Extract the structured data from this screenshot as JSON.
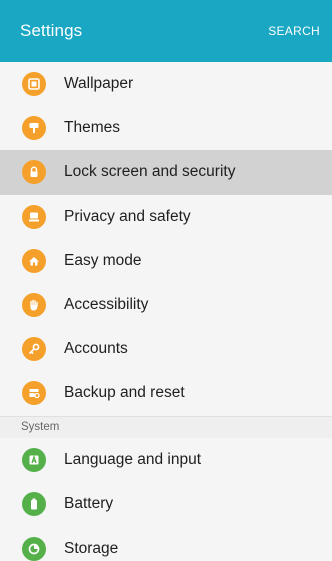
{
  "header": {
    "title": "Settings",
    "search_label": "SEARCH",
    "color": "#19a7c4"
  },
  "personal_items": [
    {
      "label": "Wallpaper",
      "icon": "wallpaper-icon",
      "color": "#f5a02a"
    },
    {
      "label": "Themes",
      "icon": "themes-brush-icon",
      "color": "#f5a02a"
    },
    {
      "label": "Lock screen and security",
      "icon": "lock-icon",
      "color": "#f5a02a",
      "selected": true
    },
    {
      "label": "Privacy and safety",
      "icon": "privacy-person-icon",
      "color": "#f5a02a"
    },
    {
      "label": "Easy mode",
      "icon": "home-icon",
      "color": "#f5a02a"
    },
    {
      "label": "Accessibility",
      "icon": "hand-icon",
      "color": "#f5a02a"
    },
    {
      "label": "Accounts",
      "icon": "key-icon",
      "color": "#f5a02a"
    },
    {
      "label": "Backup and reset",
      "icon": "backup-icon",
      "color": "#f5a02a"
    }
  ],
  "system_section": {
    "title": "System",
    "items": [
      {
        "label": "Language and input",
        "icon": "language-icon",
        "color": "#55b04a"
      },
      {
        "label": "Battery",
        "icon": "battery-icon",
        "color": "#55b04a"
      },
      {
        "label": "Storage",
        "icon": "storage-icon",
        "color": "#55b04a"
      }
    ]
  }
}
